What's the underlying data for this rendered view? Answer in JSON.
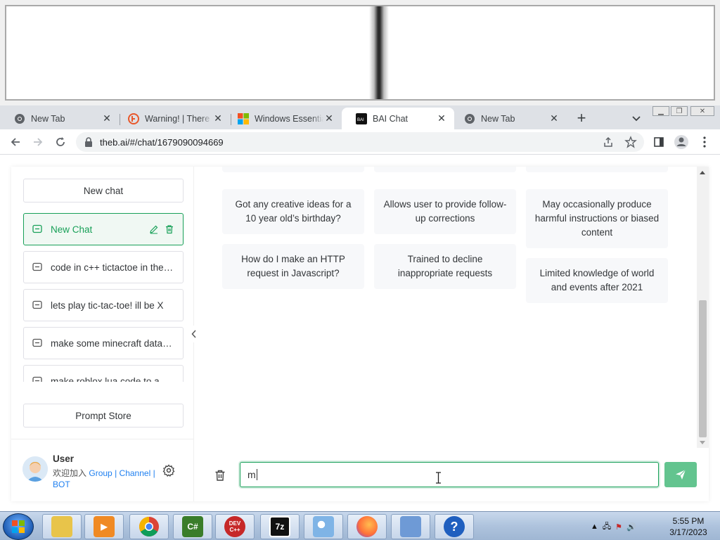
{
  "browser": {
    "tabs": [
      {
        "title": "New Tab",
        "icon": "chrome-icon",
        "active": false
      },
      {
        "title": "Warning! | There is",
        "icon": "warning-site-icon",
        "active": false
      },
      {
        "title": "Windows Essentials",
        "icon": "windows-icon",
        "active": false
      },
      {
        "title": "BAI Chat",
        "icon": "bai-icon",
        "active": true
      },
      {
        "title": "New Tab",
        "icon": "chrome-icon",
        "active": false
      }
    ],
    "url": "theb.ai/#/chat/1679090094669"
  },
  "sidebar": {
    "new_chat_label": "New chat",
    "history": [
      {
        "label": "New Chat",
        "active": true
      },
      {
        "label": "code in c++ tictactoe in the console"
      },
      {
        "label": "lets play tic-tac-toe! ill be X"
      },
      {
        "label": "make some minecraft datapacks"
      },
      {
        "label": "make roblox lua code to a"
      }
    ],
    "prompt_store_label": "Prompt Store",
    "user": {
      "name": "User",
      "desc_prefix": "欢迎加入",
      "links": [
        "Group",
        "Channel",
        "BOT"
      ],
      "sep": "|"
    }
  },
  "main": {
    "cards": [
      {
        "text": "Got any creative ideas for a 10 year old’s birthday?"
      },
      {
        "text": "Allows user to provide follow-up corrections"
      },
      {
        "text": "May occasionally produce harmful instructions or biased content"
      },
      {
        "text": "How do I make an HTTP request in Javascript?"
      },
      {
        "text": "Trained to decline inappropriate requests"
      },
      {
        "text": "Limited knowledge of world and events after 2021"
      }
    ],
    "input_value": "m"
  },
  "taskbar": {
    "apps": [
      "explorer-icon",
      "media-player-icon",
      "chrome-icon",
      "csharp-icon",
      "dev-cpp-icon",
      "7zip-icon",
      "paint-icon",
      "firefox-icon",
      "network-icon",
      "help-icon"
    ],
    "app_texts": {
      "csharp": "C#",
      "devcpp": "DEV C++",
      "zip": "7z",
      "help": "?"
    },
    "time": "5:55 PM",
    "date": "3/17/2023"
  },
  "colors": {
    "accent": "#18a058",
    "send": "#63c48f",
    "link": "#2080f0"
  }
}
